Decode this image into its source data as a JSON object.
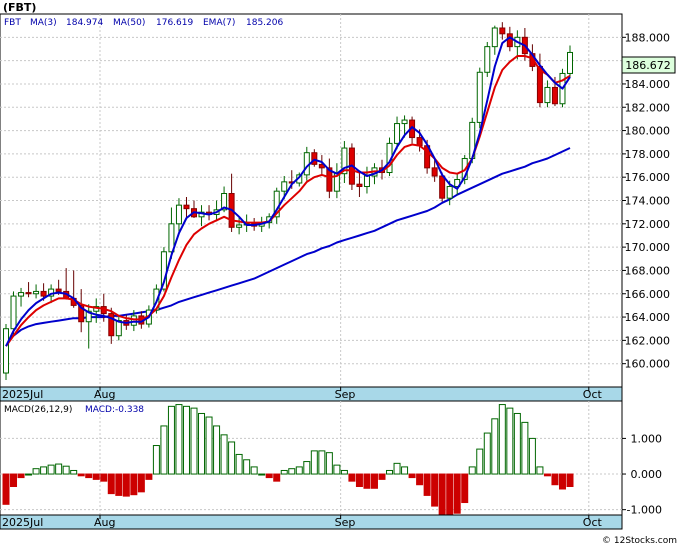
{
  "header": {
    "symbol": "(FBT)",
    "legend": [
      {
        "text": "FBT",
        "color": "#0000aa"
      },
      {
        "text": "MA(3)",
        "color": "#0000aa"
      },
      {
        "text": "184.974",
        "color": "#0000aa"
      },
      {
        "text": "MA(50)",
        "color": "#0000aa"
      },
      {
        "text": "176.619",
        "color": "#0000aa"
      },
      {
        "text": "EMA(7)",
        "color": "#0000aa"
      },
      {
        "text": "185.206",
        "color": "#0000aa"
      }
    ]
  },
  "macd_header": {
    "title": "MACD(26,12,9)",
    "value_label": "MACD:-0.338"
  },
  "footer": {
    "text": "© 12Stocks.com"
  },
  "last_price_label": "186.672",
  "colors": {
    "up_candle_fill": "#ffffff",
    "up_candle_stroke": "#006600",
    "down_candle_fill": "#dd0000",
    "ma_line": "#0000cc",
    "ema_line": "#dd0000",
    "macd_pos": "#006600",
    "macd_neg": "#cc0000",
    "grid": "#c8c8c8",
    "month_band": "#a8d8e8",
    "price_box": "#ddffdd"
  },
  "chart_data": [
    {
      "type": "candlestick",
      "title": "(FBT)",
      "x_labels": [
        "2025Jul",
        "Aug",
        "Sep",
        "Oct"
      ],
      "x_label_index": [
        0,
        13,
        45,
        78
      ],
      "ylim": [
        158,
        190
      ],
      "yticks": [
        160,
        162,
        164,
        166,
        168,
        170,
        172,
        174,
        176,
        178,
        180,
        182,
        184,
        186,
        188
      ],
      "ohlc": [
        [
          159.2,
          163.4,
          158.6,
          163.0
        ],
        [
          163.0,
          166.2,
          162.5,
          165.8
        ],
        [
          165.8,
          166.5,
          164.9,
          166.1
        ],
        [
          166.1,
          167.0,
          165.7,
          166.0
        ],
        [
          166.0,
          166.8,
          165.6,
          166.2
        ],
        [
          166.2,
          166.9,
          165.4,
          165.8
        ],
        [
          165.8,
          166.8,
          165.2,
          166.4
        ],
        [
          166.4,
          167.2,
          165.9,
          166.2
        ],
        [
          166.2,
          168.2,
          165.5,
          165.6
        ],
        [
          165.6,
          168.0,
          164.8,
          165.0
        ],
        [
          165.0,
          166.4,
          162.7,
          163.6
        ],
        [
          163.6,
          165.1,
          161.3,
          164.5
        ],
        [
          164.5,
          165.6,
          163.5,
          164.9
        ],
        [
          164.9,
          166.0,
          163.6,
          164.3
        ],
        [
          164.3,
          164.8,
          161.7,
          162.4
        ],
        [
          162.4,
          164.0,
          162.0,
          163.7
        ],
        [
          163.7,
          164.2,
          162.9,
          163.3
        ],
        [
          163.3,
          164.6,
          162.8,
          164.1
        ],
        [
          164.1,
          164.5,
          163.0,
          163.4
        ],
        [
          163.4,
          165.0,
          163.1,
          164.6
        ],
        [
          164.6,
          166.8,
          164.3,
          166.4
        ],
        [
          166.4,
          170.0,
          166.2,
          169.6
        ],
        [
          169.6,
          173.4,
          169.0,
          172.0
        ],
        [
          172.0,
          174.2,
          171.2,
          173.6
        ],
        [
          173.6,
          174.3,
          172.5,
          173.3
        ],
        [
          173.3,
          174.0,
          172.5,
          172.6
        ],
        [
          172.6,
          173.6,
          171.8,
          173.0
        ],
        [
          173.0,
          173.6,
          172.3,
          172.8
        ],
        [
          172.8,
          174.0,
          172.2,
          173.2
        ],
        [
          173.2,
          175.2,
          173.0,
          174.6
        ],
        [
          174.6,
          176.3,
          171.3,
          171.7
        ],
        [
          171.7,
          172.6,
          171.1,
          171.9
        ],
        [
          171.9,
          172.8,
          171.3,
          172.0
        ],
        [
          172.0,
          172.5,
          171.4,
          171.8
        ],
        [
          171.8,
          172.6,
          171.3,
          172.1
        ],
        [
          172.1,
          172.9,
          171.6,
          172.6
        ],
        [
          172.6,
          175.1,
          172.0,
          174.8
        ],
        [
          174.8,
          176.1,
          174.1,
          175.6
        ],
        [
          175.6,
          176.6,
          175.0,
          175.5
        ],
        [
          175.5,
          176.4,
          175.2,
          176.2
        ],
        [
          176.2,
          178.6,
          175.7,
          178.1
        ],
        [
          178.1,
          178.4,
          176.9,
          177.1
        ],
        [
          177.1,
          177.9,
          176.1,
          176.8
        ],
        [
          176.8,
          177.6,
          174.2,
          174.8
        ],
        [
          174.8,
          177.2,
          174.2,
          176.3
        ],
        [
          176.3,
          179.1,
          175.5,
          178.5
        ],
        [
          178.5,
          178.9,
          174.9,
          175.4
        ],
        [
          175.4,
          176.4,
          174.3,
          175.2
        ],
        [
          175.2,
          176.9,
          174.6,
          176.1
        ],
        [
          176.1,
          177.2,
          175.4,
          176.8
        ],
        [
          176.8,
          177.5,
          175.8,
          176.4
        ],
        [
          176.4,
          179.4,
          176.1,
          178.9
        ],
        [
          178.9,
          181.2,
          178.4,
          180.6
        ],
        [
          180.6,
          181.3,
          179.4,
          180.9
        ],
        [
          180.9,
          181.2,
          178.9,
          179.4
        ],
        [
          179.4,
          180.1,
          178.2,
          178.7
        ],
        [
          178.7,
          179.2,
          176.3,
          176.8
        ],
        [
          176.8,
          177.6,
          175.6,
          176.1
        ],
        [
          176.1,
          176.4,
          173.9,
          174.2
        ],
        [
          174.2,
          175.7,
          173.6,
          175.2
        ],
        [
          175.2,
          176.3,
          174.5,
          175.8
        ],
        [
          175.8,
          177.9,
          175.4,
          177.6
        ],
        [
          177.6,
          181.1,
          177.2,
          180.7
        ],
        [
          180.7,
          185.4,
          180.2,
          185.0
        ],
        [
          185.0,
          187.6,
          184.6,
          187.2
        ],
        [
          187.2,
          189.0,
          186.5,
          188.8
        ],
        [
          188.8,
          189.3,
          187.8,
          188.3
        ],
        [
          188.3,
          188.9,
          186.8,
          187.2
        ],
        [
          187.2,
          188.6,
          186.1,
          188.0
        ],
        [
          188.0,
          188.8,
          186.0,
          186.6
        ],
        [
          186.6,
          187.4,
          185.1,
          185.5
        ],
        [
          185.5,
          186.6,
          182.0,
          182.4
        ],
        [
          182.4,
          184.3,
          182.0,
          183.7
        ],
        [
          183.7,
          184.6,
          182.1,
          182.3
        ],
        [
          182.3,
          185.3,
          182.0,
          184.9
        ],
        [
          184.9,
          187.3,
          184.6,
          186.7
        ]
      ],
      "ma3": [
        161.5,
        162.8,
        163.8,
        164.6,
        165.2,
        165.6,
        166.0,
        166.1,
        166.0,
        165.6,
        164.8,
        164.4,
        164.2,
        164.1,
        163.9,
        163.6,
        163.5,
        163.6,
        163.6,
        164.0,
        165.3,
        167.0,
        169.3,
        171.2,
        172.5,
        173.0,
        172.9,
        172.8,
        173.0,
        173.4,
        173.2,
        172.6,
        171.9,
        171.9,
        172.0,
        172.2,
        173.2,
        174.3,
        175.4,
        176.0,
        176.9,
        177.5,
        177.3,
        176.6,
        176.3,
        176.8,
        177.0,
        176.5,
        176.1,
        176.3,
        176.6,
        177.3,
        178.6,
        179.6,
        180.3,
        179.8,
        178.8,
        177.6,
        176.2,
        175.4,
        175.0,
        176.0,
        177.6,
        179.8,
        182.6,
        185.5,
        187.5,
        188.0,
        187.6,
        187.3,
        186.5,
        185.6,
        184.8,
        184.1,
        183.6,
        184.6
      ],
      "ema7": [
        161.5,
        162.4,
        163.3,
        164.0,
        164.6,
        165.0,
        165.3,
        165.6,
        165.6,
        165.5,
        165.1,
        164.9,
        164.8,
        164.7,
        164.5,
        164.1,
        163.9,
        163.8,
        163.8,
        164.1,
        164.7,
        165.8,
        167.4,
        168.9,
        170.2,
        171.1,
        171.6,
        172.0,
        172.3,
        172.6,
        172.3,
        172.2,
        172.1,
        172.1,
        172.1,
        172.2,
        172.9,
        173.6,
        174.2,
        174.8,
        175.6,
        176.0,
        176.2,
        176.0,
        176.1,
        176.6,
        176.6,
        176.4,
        176.4,
        176.5,
        176.5,
        177.0,
        177.9,
        178.6,
        178.8,
        178.7,
        178.2,
        177.6,
        176.8,
        176.4,
        176.3,
        176.6,
        177.6,
        179.5,
        181.6,
        183.7,
        185.2,
        185.9,
        186.4,
        186.4,
        186.2,
        185.2,
        184.8,
        184.1,
        184.3,
        184.7
      ],
      "ma50": [
        161.8,
        162.4,
        162.9,
        163.2,
        163.4,
        163.5,
        163.6,
        163.7,
        163.8,
        163.9,
        163.9,
        164.0,
        164.0,
        164.0,
        164.1,
        164.1,
        164.2,
        164.3,
        164.4,
        164.5,
        164.6,
        164.8,
        165.0,
        165.3,
        165.5,
        165.7,
        165.9,
        166.1,
        166.3,
        166.5,
        166.7,
        166.9,
        167.1,
        167.3,
        167.6,
        167.9,
        168.2,
        168.5,
        168.8,
        169.1,
        169.4,
        169.6,
        169.9,
        170.1,
        170.4,
        170.6,
        170.8,
        171.0,
        171.2,
        171.4,
        171.7,
        172.0,
        172.3,
        172.5,
        172.7,
        172.9,
        173.1,
        173.4,
        173.8,
        174.1,
        174.5,
        174.8,
        175.1,
        175.4,
        175.7,
        176.0,
        176.3,
        176.5,
        176.7,
        176.9,
        177.2,
        177.4,
        177.6,
        177.9,
        178.2,
        178.5
      ]
    },
    {
      "type": "bar",
      "title": "MACD(26,12,9)",
      "ylim": [
        -1.15,
        2.05
      ],
      "yticks": [
        1.0,
        0.0,
        -1.0
      ],
      "ytick_labels": [
        "1.000",
        "0.000",
        "-1.000"
      ],
      "x_labels": [
        "2025Jul",
        "Aug",
        "Sep",
        "Oct"
      ],
      "values": [
        -0.85,
        -0.35,
        -0.1,
        0.0,
        0.15,
        0.2,
        0.25,
        0.28,
        0.22,
        0.1,
        -0.05,
        -0.1,
        -0.15,
        -0.2,
        -0.55,
        -0.6,
        -0.62,
        -0.58,
        -0.5,
        -0.15,
        0.8,
        1.35,
        1.9,
        1.95,
        1.9,
        1.85,
        1.7,
        1.6,
        1.35,
        1.1,
        0.9,
        0.55,
        0.4,
        0.2,
        0.0,
        -0.1,
        -0.2,
        0.1,
        0.15,
        0.2,
        0.35,
        0.65,
        0.65,
        0.6,
        0.25,
        0.1,
        -0.2,
        -0.35,
        -0.4,
        -0.4,
        -0.15,
        0.1,
        0.3,
        0.2,
        -0.1,
        -0.3,
        -0.6,
        -0.9,
        -1.15,
        -1.15,
        -1.1,
        -0.8,
        0.2,
        0.7,
        1.15,
        1.55,
        1.95,
        1.85,
        1.7,
        1.45,
        1.0,
        0.2,
        -0.05,
        -0.3,
        -0.42,
        -0.35
      ]
    }
  ]
}
